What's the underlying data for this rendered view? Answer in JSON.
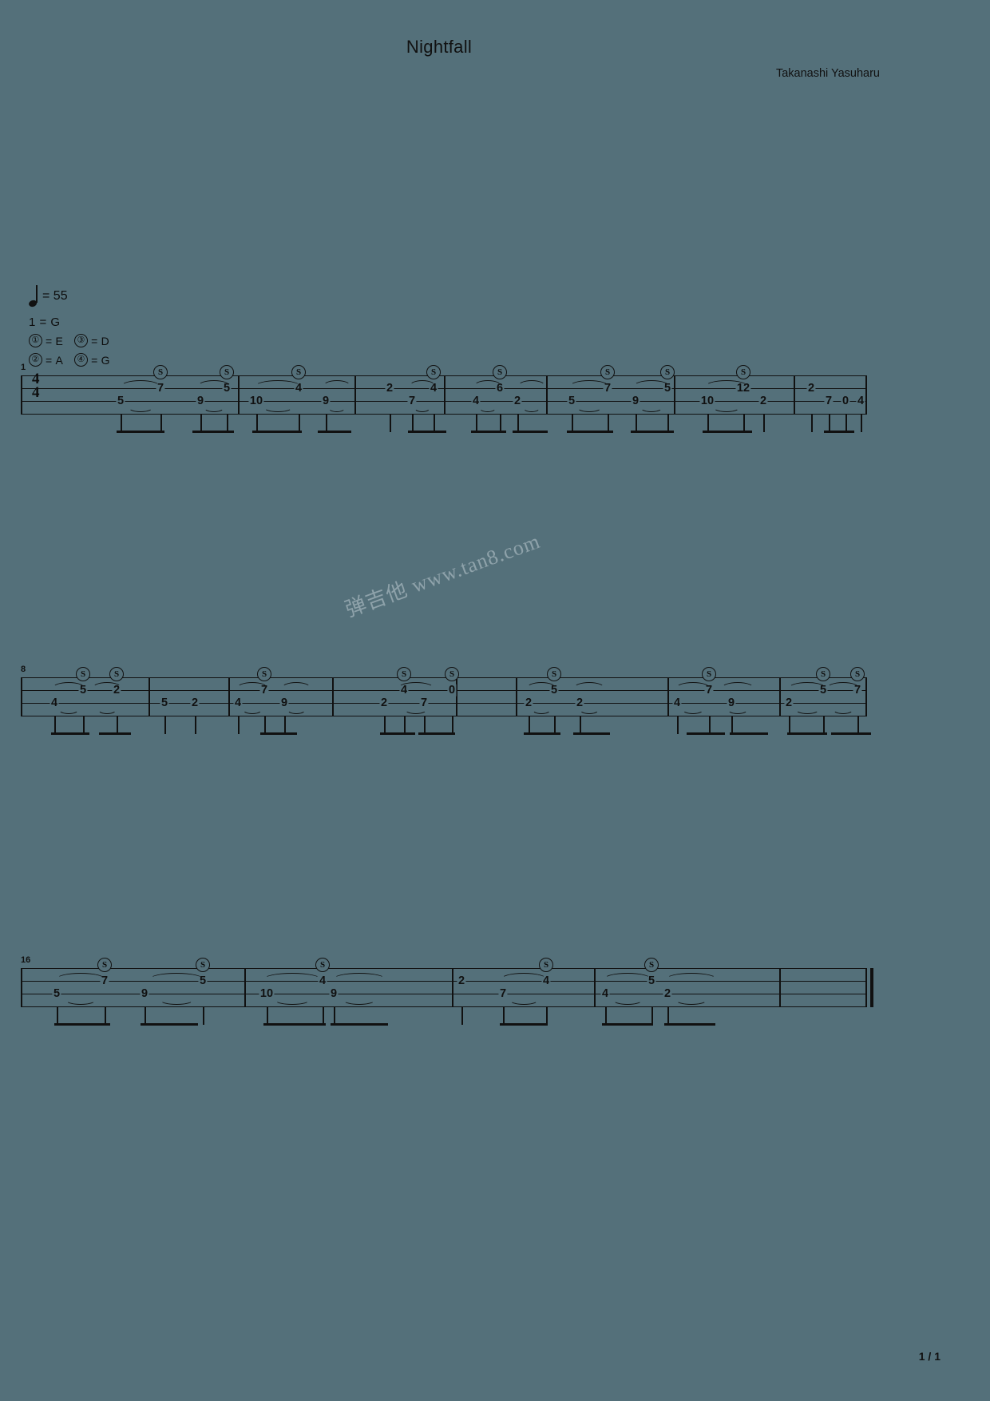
{
  "document": {
    "title": "Nightfall",
    "composer": "Takanashi Yasuharu",
    "page_number": "1 / 1",
    "watermark": "弹吉他 www.tan8.com",
    "background_color": "#54707a",
    "ink_color": "#0d0d0d"
  },
  "score_info": {
    "tempo_label": "= 55",
    "tempo_bpm": "55",
    "tempo_note": "quarter-note",
    "capo": "1 = G",
    "tuning": [
      {
        "string": "①",
        "eq": "=",
        "note": "E"
      },
      {
        "string": "③",
        "eq": "=",
        "note": "D"
      },
      {
        "string": "②",
        "eq": "=",
        "note": "A"
      },
      {
        "string": "④",
        "eq": "=",
        "note": "G"
      }
    ],
    "time_signature": {
      "top": "4",
      "bottom": "4"
    },
    "staff_type": "tab",
    "staff_lines": 4
  },
  "systems": [
    {
      "number": "1",
      "measures": [
        {
          "notes": [
            "5",
            "7",
            "9",
            "5"
          ]
        },
        {
          "notes": [
            "10",
            "4",
            "9"
          ]
        },
        {
          "notes": [
            "2",
            "7",
            "4"
          ]
        },
        {
          "notes": [
            "4",
            "6",
            "2"
          ]
        },
        {
          "notes": [
            "5",
            "7",
            "9",
            "5"
          ]
        },
        {
          "notes": [
            "10",
            "12",
            "2"
          ]
        },
        {
          "notes": [
            "2",
            "7",
            "0",
            "4"
          ]
        }
      ]
    },
    {
      "number": "8",
      "measures": [
        {
          "notes": [
            "4",
            "5",
            "2"
          ]
        },
        {
          "notes": [
            "5",
            "2"
          ]
        },
        {
          "notes": [
            "4",
            "7",
            "9"
          ]
        },
        {
          "notes": [
            "2",
            "4",
            "7",
            "0"
          ]
        },
        {
          "notes": [
            "2",
            "5",
            "2"
          ]
        },
        {
          "notes": [
            "4",
            "7",
            "9"
          ]
        },
        {
          "notes": [
            "2",
            "5",
            "7"
          ]
        }
      ]
    },
    {
      "number": "16",
      "measures": [
        {
          "notes": [
            "5",
            "7",
            "9",
            "5"
          ]
        },
        {
          "notes": [
            "10",
            "4",
            "9"
          ]
        },
        {
          "notes": [
            "2",
            "7",
            "4"
          ]
        },
        {
          "notes": [
            "4",
            "5",
            "2"
          ]
        },
        {
          "notes": []
        }
      ]
    }
  ]
}
